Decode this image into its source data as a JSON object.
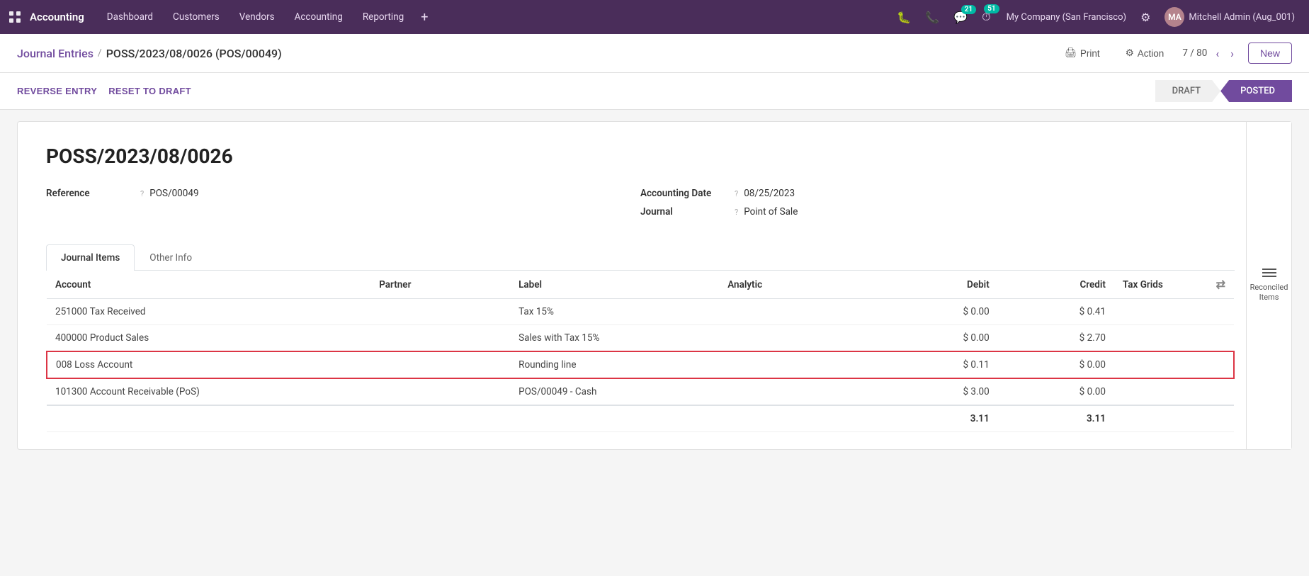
{
  "app": {
    "name": "Accounting",
    "nav_items": [
      "Dashboard",
      "Customers",
      "Vendors",
      "Accounting",
      "Reporting"
    ],
    "plus_label": "+",
    "notifications": {
      "chat_count": "21",
      "activity_count": "51"
    },
    "company": "My Company (San Francisco)",
    "user": "Mitchell Admin (Aug_001)"
  },
  "breadcrumb": {
    "parent": "Journal Entries",
    "separator": "/",
    "current": "POSS/2023/08/0026 (POS/00049)"
  },
  "toolbar": {
    "print_label": "Print",
    "action_label": "Action",
    "pagination": "7 / 80",
    "new_label": "New"
  },
  "status_bar": {
    "reverse_entry_label": "REVERSE ENTRY",
    "reset_to_draft_label": "RESET TO DRAFT",
    "steps": [
      "DRAFT",
      "POSTED"
    ]
  },
  "reconciled_items": {
    "label": "Reconciled Items"
  },
  "form": {
    "doc_number": "POSS/2023/08/0026",
    "fields": {
      "reference_label": "Reference",
      "reference_help": "?",
      "reference_value": "POS/00049",
      "accounting_date_label": "Accounting Date",
      "accounting_date_help": "?",
      "accounting_date_value": "08/25/2023",
      "journal_label": "Journal",
      "journal_help": "?",
      "journal_value": "Point of Sale"
    }
  },
  "tabs": [
    {
      "id": "journal-items",
      "label": "Journal Items",
      "active": true
    },
    {
      "id": "other-info",
      "label": "Other Info",
      "active": false
    }
  ],
  "table": {
    "headers": [
      "Account",
      "Partner",
      "Label",
      "Analytic",
      "Debit",
      "Credit",
      "Tax Grids"
    ],
    "rows": [
      {
        "account": "251000 Tax Received",
        "partner": "",
        "label": "Tax 15%",
        "analytic": "",
        "debit": "$ 0.00",
        "credit": "$ 0.41",
        "tax_grids": "",
        "highlighted": false
      },
      {
        "account": "400000 Product Sales",
        "partner": "",
        "label": "Sales with Tax 15%",
        "analytic": "",
        "debit": "$ 0.00",
        "credit": "$ 2.70",
        "tax_grids": "",
        "highlighted": false
      },
      {
        "account": "008 Loss Account",
        "partner": "",
        "label": "Rounding line",
        "analytic": "",
        "debit": "$ 0.11",
        "credit": "$ 0.00",
        "tax_grids": "",
        "highlighted": true
      },
      {
        "account": "101300 Account Receivable (PoS)",
        "partner": "",
        "label": "POS/00049 - Cash",
        "analytic": "",
        "debit": "$ 3.00",
        "credit": "$ 0.00",
        "tax_grids": "",
        "highlighted": false
      }
    ],
    "totals": {
      "debit": "3.11",
      "credit": "3.11"
    }
  }
}
